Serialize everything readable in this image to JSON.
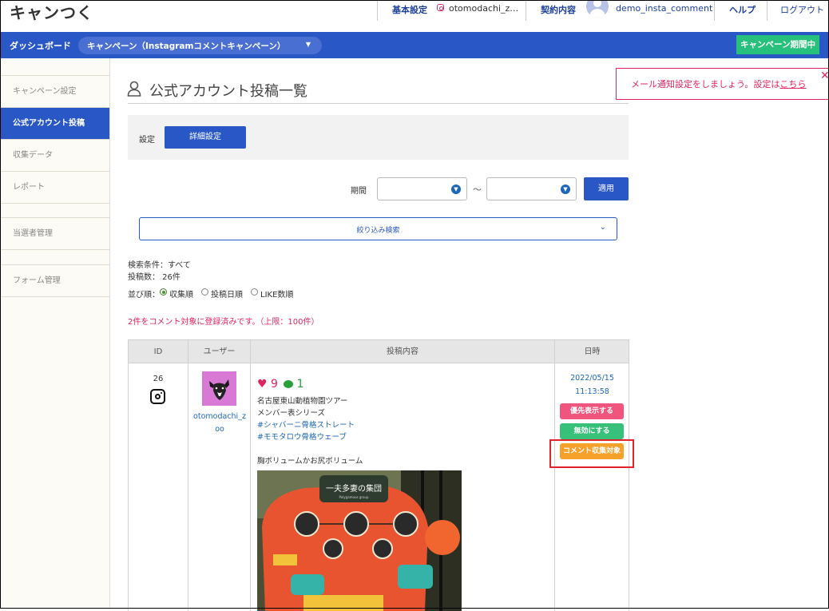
{
  "header": {
    "logo": "キャンつく",
    "nav": {
      "basic_settings": "基本設定",
      "instagram_account": "otomodachi_z…",
      "contract": "契約内容",
      "user": "demo_insta_comment",
      "help": "ヘルプ",
      "logout": "ログアウト"
    }
  },
  "navbar": {
    "dashboard": "ダッシュボード",
    "campaign_select": "キャンペーン（Instagramコメントキャンペーン）",
    "status": "キャンペーン期間中"
  },
  "sidebar": {
    "items": [
      {
        "label": "キャンペーン設定"
      },
      {
        "label": "公式アカウント投稿"
      },
      {
        "label": "収集データ"
      },
      {
        "label": "レポート"
      },
      {
        "label": "当選者管理"
      },
      {
        "label": "フォーム管理"
      }
    ]
  },
  "page": {
    "title": "公式アカウント投稿一覧",
    "settings_label": "設定",
    "detail_settings_button": "詳細設定",
    "period_label": "期間",
    "period_separator": "〜",
    "apply_button": "適用",
    "filter_label": "絞り込み検索",
    "search_condition": "検索条件：すべて",
    "post_count": "投稿数： 26件",
    "sort_label": "並び順：",
    "sort_options": [
      "収集順",
      "投稿日順",
      "LIKE数順"
    ],
    "registered_message": "2件をコメント対象に登録済みです。（上限：100件）"
  },
  "notification": {
    "text": "メール通知設定をしましょう。設定は",
    "link": "こちら"
  },
  "table": {
    "headers": [
      "ID",
      "ユーザー",
      "投稿内容",
      "日時"
    ],
    "row": {
      "id": "26",
      "username": "otomodachi_zoo",
      "likes": "9",
      "comments": "1",
      "lines": [
        "名古屋東山動植物園ツアー",
        "メンバー表シリーズ"
      ],
      "tags": [
        "#シャバーニ骨格ストレート",
        "#モモタロウ骨格ウェーブ"
      ],
      "line_extra": "胸ボリュームかお尻ボリューム",
      "date": "2022/05/15",
      "time": "11:13:58",
      "actions": {
        "priority": "優先表示する",
        "disable": "無効にする",
        "comment_target": "コメント収集対象"
      },
      "photo_text": {
        "heading": "一夫多妻の集団",
        "subheading": "Polygamous group"
      }
    }
  },
  "colors": {
    "primary": "#2a57c6",
    "status": "#27c07d",
    "accent_red": "#e0245e",
    "priority_btn": "#f0557e",
    "disable_btn": "#36c07a",
    "comment_btn": "#f5a12b"
  }
}
